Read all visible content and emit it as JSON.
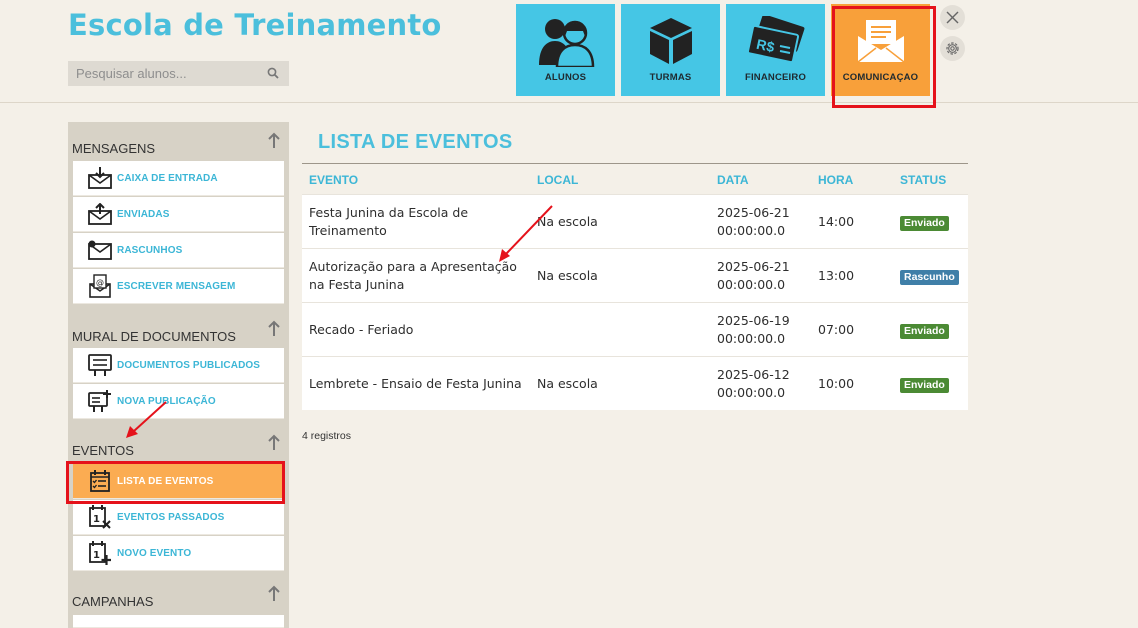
{
  "app": {
    "title": "Escola de Treinamento"
  },
  "search": {
    "placeholder": "Pesquisar alunos..."
  },
  "modules": [
    {
      "label": "ALUNOS",
      "icon": "students-icon"
    },
    {
      "label": "TURMAS",
      "icon": "box-icon"
    },
    {
      "label": "FINANCEIRO",
      "icon": "money-icon"
    },
    {
      "label": "COMUNICAÇAO",
      "icon": "envelope-icon",
      "active": true
    }
  ],
  "sidebar": {
    "mensagens": {
      "title": "MENSAGENS",
      "items": [
        {
          "label": "CAIXA DE ENTRADA",
          "icon": "inbox-icon"
        },
        {
          "label": "ENVIADAS",
          "icon": "sent-icon"
        },
        {
          "label": "RASCUNHOS",
          "icon": "draft-icon"
        },
        {
          "label": "ESCREVER MENSAGEM",
          "icon": "compose-icon"
        }
      ]
    },
    "mural": {
      "title": "MURAL DE DOCUMENTOS",
      "items": [
        {
          "label": "DOCUMENTOS PUBLICADOS",
          "icon": "board-icon"
        },
        {
          "label": "NOVA PUBLICAÇÃO",
          "icon": "board-add-icon"
        }
      ]
    },
    "eventos": {
      "title": "EVENTOS",
      "items": [
        {
          "label": "LISTA DE EVENTOS",
          "icon": "calendar-list-icon",
          "active": true
        },
        {
          "label": "EVENTOS PASSADOS",
          "icon": "calendar-x-icon"
        },
        {
          "label": "NOVO EVENTO",
          "icon": "calendar-add-icon"
        }
      ]
    },
    "campanhas": {
      "title": "CAMPANHAS"
    }
  },
  "main": {
    "title": "LISTA DE EVENTOS",
    "columns": [
      "EVENTO",
      "LOCAL",
      "DATA",
      "HORA",
      "STATUS"
    ],
    "rows": [
      {
        "evento": "Festa Junina da Escola de Treinamento",
        "local": "Na escola",
        "data": "2025-06-21 00:00:00.0",
        "hora": "14:00",
        "status": "Enviado",
        "status_type": "sent"
      },
      {
        "evento": "Autorização para a Apresentação na Festa Junina",
        "local": "Na escola",
        "data": "2025-06-21 00:00:00.0",
        "hora": "13:00",
        "status": "Rascunho",
        "status_type": "draft"
      },
      {
        "evento": "Recado - Feriado",
        "local": "",
        "data": "2025-06-19 00:00:00.0",
        "hora": "07:00",
        "status": "Enviado",
        "status_type": "sent"
      },
      {
        "evento": "Lembrete - Ensaio de Festa Junina",
        "local": "Na escola",
        "data": "2025-06-12 00:00:00.0",
        "hora": "10:00",
        "status": "Enviado",
        "status_type": "sent"
      }
    ],
    "count": "4 registros"
  },
  "colors": {
    "accent": "#4bbfdc",
    "module_bg": "#45c6e5",
    "active": "#f8a03a",
    "sent": "#4b8a34",
    "draft": "#3f7fa8",
    "highlight": "#e5121b"
  }
}
